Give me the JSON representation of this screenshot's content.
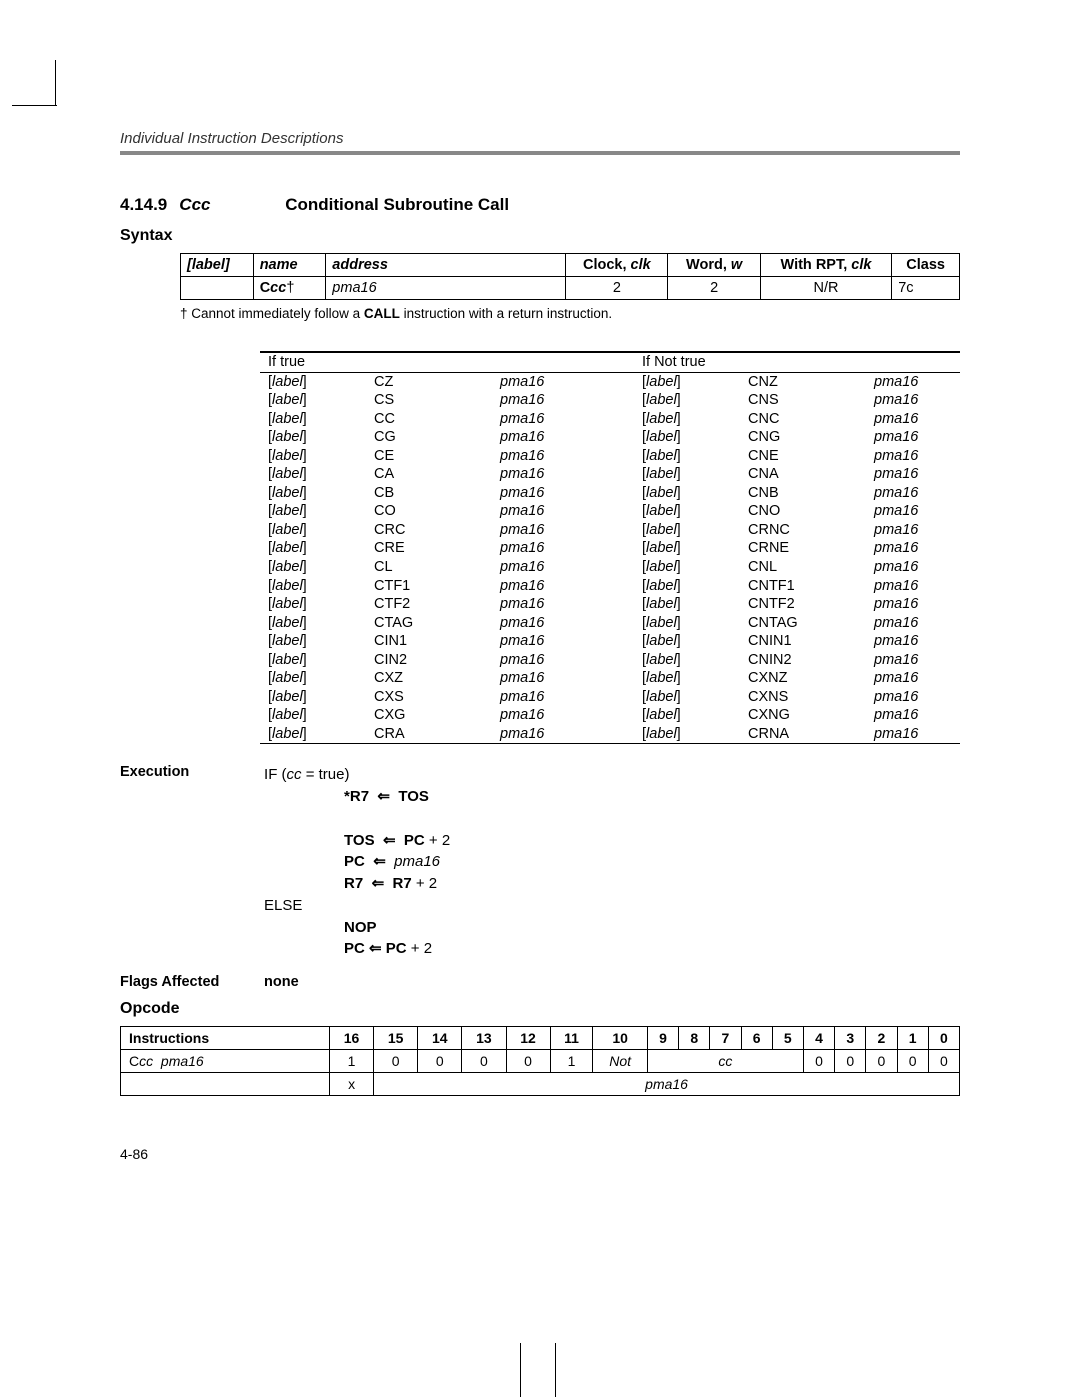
{
  "running_head": "Individual Instruction Descriptions",
  "section": {
    "number": "4.14.9",
    "name_prefix": "C",
    "name_suffix": "cc",
    "title": "Conditional Subroutine Call"
  },
  "syntax_heading": "Syntax",
  "syntax_table": {
    "headers": {
      "label": "[label]",
      "name": "name",
      "address": "address",
      "clock": "Clock",
      "clock_it": "clk",
      "word": "Word",
      "word_it": "w",
      "with_rpt": "With RPT",
      "with_rpt_it": "clk",
      "class": "Class"
    },
    "row": {
      "name_prefix": "C",
      "name_suffix": "cc",
      "dagger": "†",
      "address": "pma16",
      "clock": "2",
      "word": "2",
      "with_rpt": "N/R",
      "class": "7c"
    }
  },
  "dagger_note": {
    "pre": "† Cannot immediately follow a ",
    "bold": "CALL",
    "post": " instruction with a return instruction."
  },
  "mnemonic_table": {
    "head_true": "If true",
    "head_false": "If Not true",
    "label": "label",
    "pma": "pma16",
    "rows": [
      {
        "t": "CZ",
        "f": "CNZ"
      },
      {
        "t": "CS",
        "f": "CNS"
      },
      {
        "t": "CC",
        "f": "CNC"
      },
      {
        "t": "CG",
        "f": "CNG"
      },
      {
        "t": "CE",
        "f": "CNE"
      },
      {
        "t": "CA",
        "f": "CNA"
      },
      {
        "t": "CB",
        "f": "CNB"
      },
      {
        "t": "CO",
        "f": "CNO"
      },
      {
        "t": "CRC",
        "f": "CRNC"
      },
      {
        "t": "CRE",
        "f": "CRNE"
      },
      {
        "t": "CL",
        "f": "CNL"
      },
      {
        "t": "CTF1",
        "f": "CNTF1"
      },
      {
        "t": "CTF2",
        "f": "CNTF2"
      },
      {
        "t": "CTAG",
        "f": "CNTAG"
      },
      {
        "t": "CIN1",
        "f": "CNIN1"
      },
      {
        "t": "CIN2",
        "f": "CNIN2"
      },
      {
        "t": "CXZ",
        "f": "CXNZ"
      },
      {
        "t": "CXS",
        "f": "CXNS"
      },
      {
        "t": "CXG",
        "f": "CXNG"
      },
      {
        "t": "CRA",
        "f": "CRNA"
      }
    ]
  },
  "execution": {
    "label": "Execution",
    "if_line_pre": "IF (",
    "if_var": "cc",
    "if_line_post": " = true)",
    "l1_a": "*R7",
    "arrow": "⇐",
    "l1_b": "TOS",
    "l2_a": "TOS",
    "l2_b": "PC",
    "plus2": " + 2",
    "l3_a": "PC",
    "l3_b": "pma16",
    "l4_a": "R7",
    "l4_b": "R7",
    "else": "ELSE",
    "nop": "NOP",
    "l5_a": "PC",
    "l5_b": "PC",
    "l5_post": " + 2"
  },
  "flags": {
    "label": "Flags Affected",
    "value": "none"
  },
  "opcode_heading": "Opcode",
  "opcode": {
    "instr_header": "Instructions",
    "bits": [
      "16",
      "15",
      "14",
      "13",
      "12",
      "11",
      "10",
      "9",
      "8",
      "7",
      "6",
      "5",
      "4",
      "3",
      "2",
      "1",
      "0"
    ],
    "row1": {
      "instr_pre": "C",
      "instr_cc": "cc",
      "instr_pma": "pma16",
      "cells_a": [
        "1",
        "0",
        "0",
        "0",
        "0",
        "1"
      ],
      "not": "Not",
      "cc": "cc",
      "cells_b": [
        "0",
        "0",
        "0",
        "0",
        "0"
      ]
    },
    "row2": {
      "x": "x",
      "pma": "pma16"
    }
  },
  "page_number": "4-86"
}
